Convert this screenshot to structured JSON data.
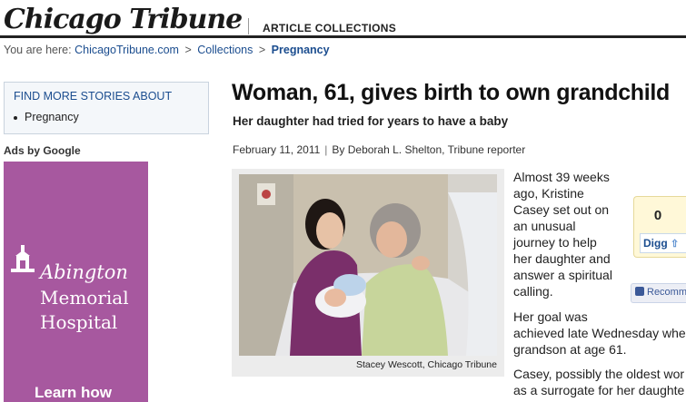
{
  "header": {
    "logo_text": "Chicago Tribune",
    "section": "ARTICLE COLLECTIONS"
  },
  "breadcrumb": {
    "prefix": "You are here:",
    "items": [
      "ChicagoTribune.com",
      "Collections",
      "Pregnancy"
    ],
    "separator": ">"
  },
  "sidebar": {
    "find_more_title": "FIND MORE STORIES ABOUT",
    "topics": [
      "Pregnancy"
    ],
    "ads_label": "Ads by Google",
    "ad": {
      "name_line1": "Abington",
      "name_line2": "Memorial",
      "name_line3": "Hospital",
      "cta": "Learn how",
      "background": "#a7589f"
    }
  },
  "article": {
    "headline": "Woman, 61, gives birth to own grandchild",
    "subhead": "Her daughter had tried for years to have a baby",
    "date": "February 11, 2011",
    "byline_separator": "|",
    "byline": "By Deborah L. Shelton, Tribune reporter",
    "photo_caption": "Stacey Wescott, Chicago Tribune",
    "paragraph1_lines": [
      "Almost 39 weeks",
      "ago, Kristine",
      "Casey set out on",
      "an unusual",
      "journey to help",
      "her daughter and",
      "answer a spiritual",
      "calling."
    ],
    "paragraph2_lines": [
      "Her goal was",
      "achieved late Wednesday whe",
      "grandson at age 61."
    ],
    "paragraph3_lines": [
      "Casey, possibly the oldest wor",
      "as a surrogate for her daughte"
    ]
  },
  "social": {
    "digg_count": "0",
    "digg_label": "Digg",
    "digg_arrow": "⇧",
    "recommend_label": "Recomm"
  }
}
